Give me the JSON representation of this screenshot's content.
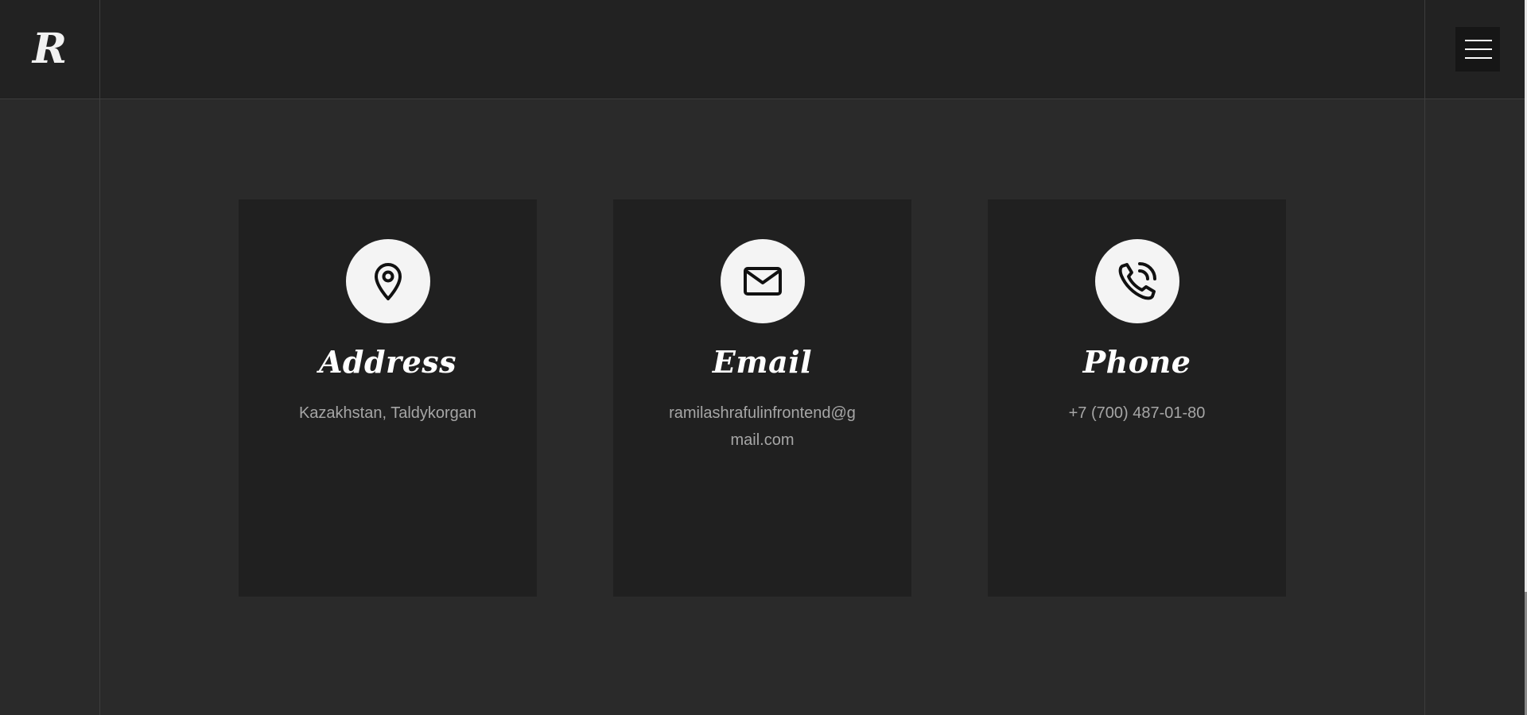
{
  "header": {
    "logo": "R",
    "menu_icon": "hamburger-menu-icon"
  },
  "cards": [
    {
      "icon": "map-pin-icon",
      "title": "Address",
      "text": "Kazakhstan, Taldykorgan"
    },
    {
      "icon": "envelope-icon",
      "title": "Email",
      "text": "ramilashrafulinfrontend@gmail.com"
    },
    {
      "icon": "phone-call-icon",
      "title": "Phone",
      "text": "+7 (700) 487-01-80"
    }
  ],
  "colors": {
    "page_bg": "#2a2a2a",
    "header_bg": "#222222",
    "card_bg": "#202020",
    "icon_circle": "#f4f4f4",
    "title": "#ffffff",
    "text": "#a6a6a6"
  }
}
